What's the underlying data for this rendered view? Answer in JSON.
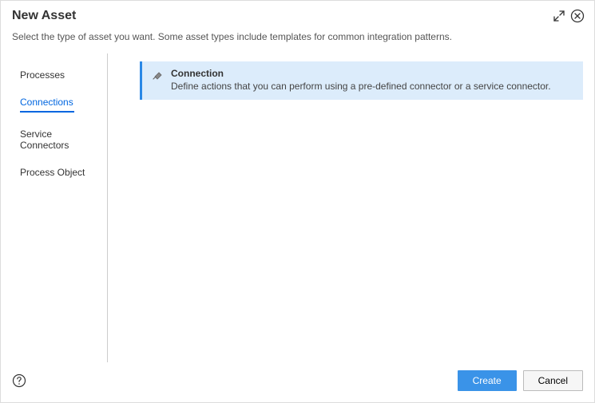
{
  "title": "New Asset",
  "subtitle": "Select the type of asset you want. Some asset types include templates for common integration patterns.",
  "sidebar": {
    "items": [
      {
        "label": "Processes",
        "active": false
      },
      {
        "label": "Connections",
        "active": true
      },
      {
        "label": "Service Connectors",
        "active": false
      },
      {
        "label": "Process Object",
        "active": false
      }
    ]
  },
  "asset": {
    "title": "Connection",
    "description": "Define actions that you can perform using a pre-defined connector or a service connector."
  },
  "footer": {
    "create_label": "Create",
    "cancel_label": "Cancel"
  }
}
